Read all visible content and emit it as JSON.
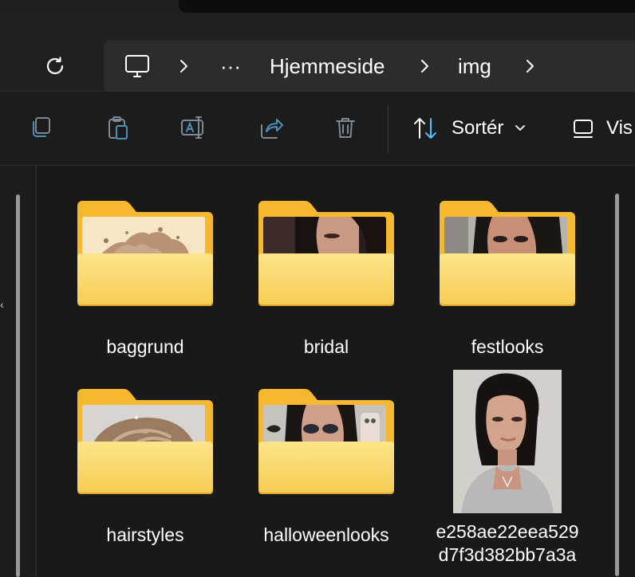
{
  "address_bar": {
    "overflow": "···",
    "crumbs": [
      "Hjemmeside",
      "img"
    ]
  },
  "toolbar": {
    "sort_label": "Sortér",
    "view_label": "Vis"
  },
  "items": [
    {
      "name": "baggrund",
      "kind": "folder"
    },
    {
      "name": "bridal",
      "kind": "folder"
    },
    {
      "name": "festlooks",
      "kind": "folder"
    },
    {
      "name": "hairstyles",
      "kind": "folder"
    },
    {
      "name": "halloweenlooks",
      "kind": "folder"
    },
    {
      "name_line1": "e258ae22eea529",
      "name_line2": "d7f3d382bb7a3a",
      "kind": "image"
    }
  ],
  "colors": {
    "background": "#191919",
    "folder_yellow": "#f7cd55",
    "accent_blue": "#4cc2ff"
  },
  "icons": [
    "refresh-icon",
    "computer-icon",
    "chevron-right-icon",
    "copy-icon",
    "paste-icon",
    "rename-icon",
    "share-icon",
    "delete-icon",
    "sort-icon",
    "chevron-down-icon",
    "view-icon"
  ]
}
